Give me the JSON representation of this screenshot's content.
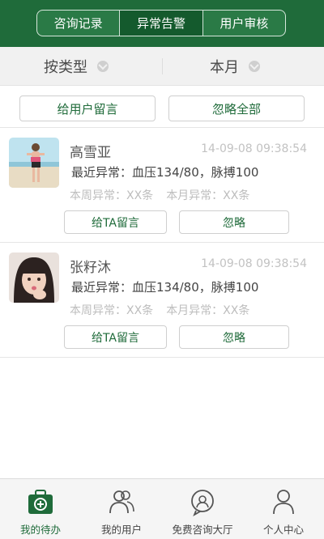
{
  "header": {
    "tabs": [
      {
        "label": "咨询记录",
        "active": false
      },
      {
        "label": "异常告警",
        "active": true
      },
      {
        "label": "用户审核",
        "active": false
      }
    ]
  },
  "filters": {
    "type_label": "按类型",
    "period_label": "本月"
  },
  "actions": {
    "message_users": "给用户留言",
    "ignore_all": "忽略全部"
  },
  "alerts": [
    {
      "name": "高雪亚",
      "time": "14-09-08 09:38:54",
      "recent": "最近异常：血压134/80，脉搏100",
      "week": "本周异常：XX条",
      "month": "本月异常：XX条",
      "message_button": "给TA留言",
      "ignore_button": "忽略"
    },
    {
      "name": "张籽沐",
      "time": "14-09-08 09:38:54",
      "recent": "最近异常：血压134/80，脉搏100",
      "week": "本周异常：XX条",
      "month": "本月异常：XX条",
      "message_button": "给TA留言",
      "ignore_button": "忽略"
    }
  ],
  "bottom_nav": {
    "items": [
      {
        "label": "我的待办",
        "icon": "medical-kit-icon",
        "active": true
      },
      {
        "label": "我的用户",
        "icon": "users-icon",
        "active": false
      },
      {
        "label": "免费咨询大厅",
        "icon": "chat-icon",
        "active": false
      },
      {
        "label": "个人中心",
        "icon": "person-icon",
        "active": false
      }
    ]
  },
  "colors": {
    "brand_green": "#1f6b3a",
    "active_tab": "#145a2d"
  }
}
